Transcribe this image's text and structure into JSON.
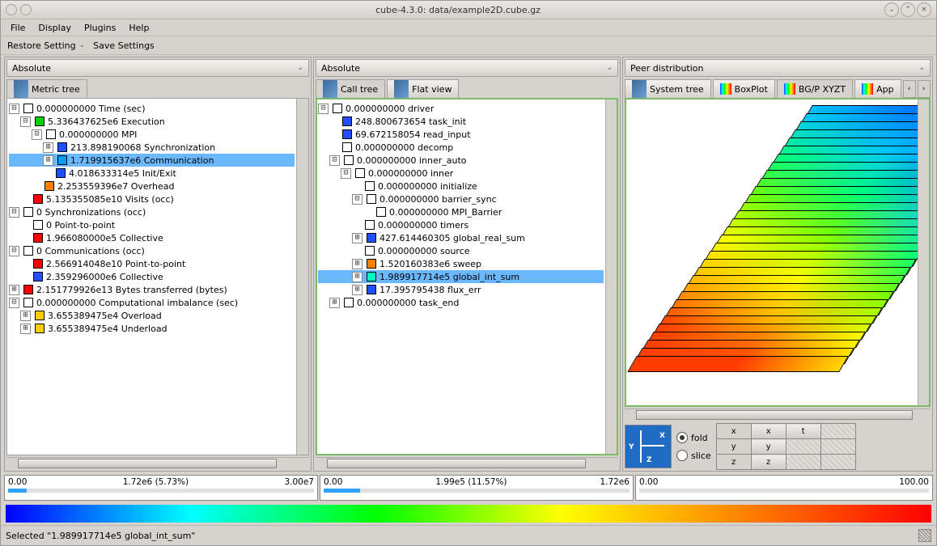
{
  "title": "cube-4.3.0: data/example2D.cube.gz",
  "menus": [
    "File",
    "Display",
    "Plugins",
    "Help"
  ],
  "settings": {
    "restore": "Restore Setting",
    "save": "Save Settings"
  },
  "panel1": {
    "combo": "Absolute",
    "tab": "Metric tree"
  },
  "panel2": {
    "combo": "Absolute",
    "tab1": "Call tree",
    "tab2": "Flat view"
  },
  "panel3": {
    "combo": "Peer distribution",
    "tabs": [
      "System tree",
      "BoxPlot",
      "BG/P XYZT",
      "App"
    ]
  },
  "metric_tree": [
    {
      "d": 0,
      "e": "-",
      "c": "#ffffff",
      "t": "0.000000000 Time (sec)"
    },
    {
      "d": 1,
      "e": "-",
      "c": "#00d000",
      "t": "5.336437625e6 Execution"
    },
    {
      "d": 2,
      "e": "-",
      "c": "#ffffff",
      "t": "0.000000000 MPI"
    },
    {
      "d": 3,
      "e": "+",
      "c": "#2050ff",
      "t": "213.898190068 Synchronization"
    },
    {
      "d": 3,
      "e": "+",
      "c": "#00a0ff",
      "t": "1.719915637e6 Communication",
      "sel": true
    },
    {
      "d": 3,
      "e": "",
      "c": "#2050ff",
      "t": "4.018633314e5 Init/Exit"
    },
    {
      "d": 2,
      "e": "",
      "c": "#ff8000",
      "t": "2.253559396e7 Overhead"
    },
    {
      "d": 1,
      "e": "",
      "c": "#ff0000",
      "t": "5.135355085e10 Visits (occ)"
    },
    {
      "d": 0,
      "e": "-",
      "c": "#ffffff",
      "t": "0 Synchronizations (occ)"
    },
    {
      "d": 1,
      "e": "",
      "c": "#ffffff",
      "t": "0 Point-to-point"
    },
    {
      "d": 1,
      "e": "",
      "c": "#ff0000",
      "t": "1.966080000e5 Collective"
    },
    {
      "d": 0,
      "e": "-",
      "c": "#ffffff",
      "t": "0 Communications (occ)"
    },
    {
      "d": 1,
      "e": "",
      "c": "#ff0000",
      "t": "2.566914048e10 Point-to-point"
    },
    {
      "d": 1,
      "e": "",
      "c": "#2050ff",
      "t": "2.359296000e6 Collective"
    },
    {
      "d": 0,
      "e": "+",
      "c": "#ff0000",
      "t": "2.151779926e13 Bytes transferred (bytes)"
    },
    {
      "d": 0,
      "e": "-",
      "c": "#ffffff",
      "t": "0.000000000 Computational imbalance (sec)"
    },
    {
      "d": 1,
      "e": "+",
      "c": "#ffcc00",
      "t": "3.655389475e4 Overload"
    },
    {
      "d": 1,
      "e": "+",
      "c": "#ffcc00",
      "t": "3.655389475e4 Underload"
    }
  ],
  "call_tree": [
    {
      "d": 0,
      "e": "-",
      "c": "#ffffff",
      "t": "0.000000000 driver"
    },
    {
      "d": 1,
      "e": "",
      "c": "#2050ff",
      "t": "248.800673654 task_init"
    },
    {
      "d": 1,
      "e": "",
      "c": "#2050ff",
      "t": "69.672158054 read_input"
    },
    {
      "d": 1,
      "e": "",
      "c": "#ffffff",
      "t": "0.000000000 decomp"
    },
    {
      "d": 1,
      "e": "-",
      "c": "#ffffff",
      "t": "0.000000000 inner_auto"
    },
    {
      "d": 2,
      "e": "-",
      "c": "#ffffff",
      "t": "0.000000000 inner"
    },
    {
      "d": 3,
      "e": "",
      "c": "#ffffff",
      "t": "0.000000000 initialize"
    },
    {
      "d": 3,
      "e": "-",
      "c": "#ffffff",
      "t": "0.000000000 barrier_sync"
    },
    {
      "d": 4,
      "e": "",
      "c": "#ffffff",
      "t": "0.000000000 MPI_Barrier"
    },
    {
      "d": 3,
      "e": "",
      "c": "#ffffff",
      "t": "0.000000000 timers"
    },
    {
      "d": 3,
      "e": "+",
      "c": "#2050ff",
      "t": "427.614460305 global_real_sum"
    },
    {
      "d": 3,
      "e": "",
      "c": "#ffffff",
      "t": "0.000000000 source"
    },
    {
      "d": 3,
      "e": "+",
      "c": "#ff8000",
      "t": "1.520160383e6 sweep"
    },
    {
      "d": 3,
      "e": "+",
      "c": "#00ffc0",
      "t": "1.989917714e5 global_int_sum",
      "sel": true
    },
    {
      "d": 3,
      "e": "+",
      "c": "#2050ff",
      "t": "17.395795438 flux_err"
    },
    {
      "d": 1,
      "e": "+",
      "c": "#ffffff",
      "t": "0.000000000 task_end"
    }
  ],
  "value1": {
    "lo": "0.00",
    "mid": "1.72e6 (5.73%)",
    "hi": "3.00e7",
    "pct": 6
  },
  "value2": {
    "lo": "0.00",
    "mid": "1.99e5 (11.57%)",
    "hi": "1.72e6",
    "pct": 12
  },
  "value3": {
    "lo": "0.00",
    "mid": "",
    "hi": "100.00",
    "pct": 0
  },
  "fold": "fold",
  "slice": "slice",
  "axrows": [
    {
      "h": "x",
      "b1": "x",
      "b2": "t"
    },
    {
      "h": "y",
      "b1": "y",
      "b2": ""
    },
    {
      "h": "z",
      "b1": "z",
      "b2": ""
    }
  ],
  "status": "Selected \"1.989917714e5 global_int_sum\""
}
